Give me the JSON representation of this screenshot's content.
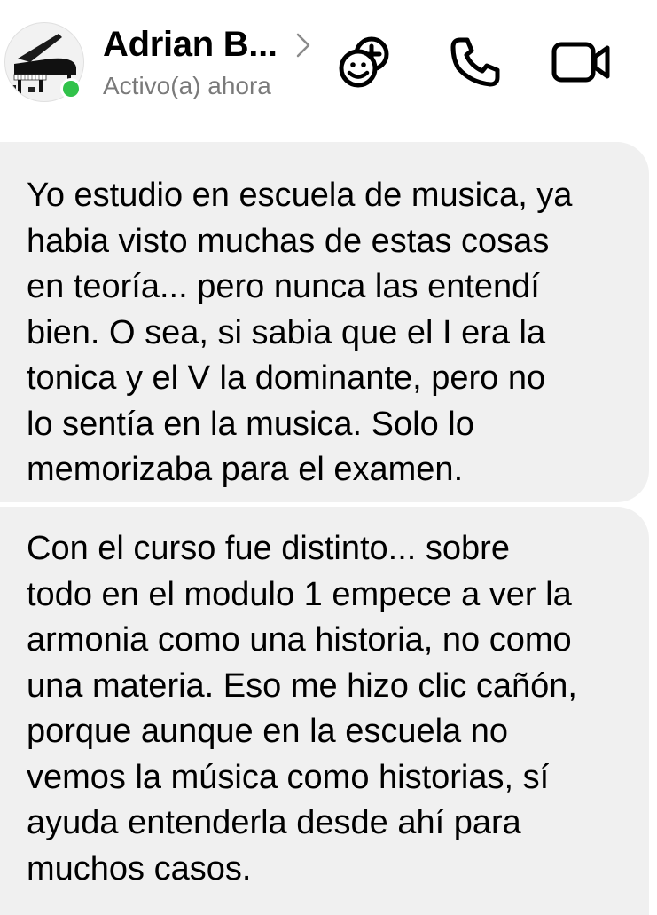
{
  "header": {
    "contact_name": "Adrian B...",
    "status": "Activo(a) ahora",
    "icons": {
      "avatar": "grand-piano-avatar",
      "chevron": "chevron-right-icon",
      "emoji": "add-emoji-icon",
      "call": "phone-icon",
      "video": "video-camera-icon"
    },
    "presence_color": "#31c24a"
  },
  "messages": [
    {
      "text": "Yo estudio en escuela de musica, ya\nhabia visto muchas de estas cosas\nen teoría... pero nunca las entendí\nbien. O sea, si sabia que el I era la\ntonica y el V la dominante, pero no\nlo sentía en la musica. Solo lo\nmemorizaba para el examen."
    },
    {
      "text": "Con el curso fue distinto... sobre\ntodo en el modulo 1 empece a ver la\narmonia como una historia, no como\nuna materia. Eso me hizo clic cañón,\nporque aunque en la escuela no\nvemos la música como historias, sí\nayuda entenderla desde ahí para\nmuchos casos."
    }
  ],
  "colors": {
    "bubble_bg": "#f0f0f0",
    "text": "#000000",
    "status": "#7a7a7a"
  }
}
